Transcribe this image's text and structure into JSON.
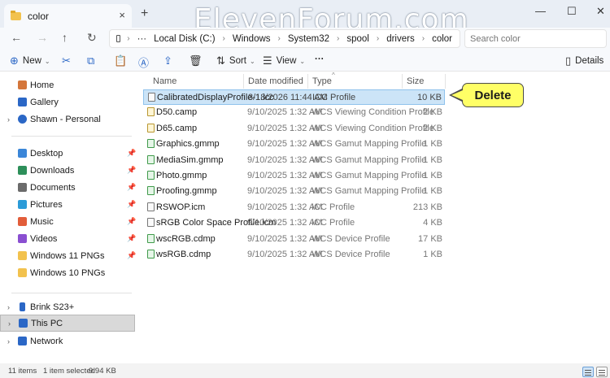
{
  "window": {
    "tab_title": "color",
    "tab_close": "×",
    "new_tab": "+",
    "watermark": "ElevenForum.com",
    "minimize": "—",
    "maximize": "☐",
    "close": "✕"
  },
  "address": {
    "back": "←",
    "forward": "→",
    "up": "↑",
    "refresh": "↻",
    "more": "···",
    "breadcrumbs": [
      "Local Disk (C:)",
      "Windows",
      "System32",
      "spool",
      "drivers",
      "color"
    ],
    "separator": "›",
    "search_placeholder": "Search color"
  },
  "toolbar": {
    "new_label": "New",
    "sort_label": "Sort",
    "view_label": "View",
    "more_label": "···",
    "details_label": "Details"
  },
  "nav": {
    "items": [
      {
        "label": "Home",
        "icon": "home-icon",
        "color": "#d4763b"
      },
      {
        "label": "Gallery",
        "icon": "gallery-icon",
        "color": "#2b67c6"
      },
      {
        "label": "Shawn - Personal",
        "icon": "cloud-icon",
        "color": "#2b67c6"
      }
    ],
    "quick": [
      {
        "label": "Desktop",
        "icon": "desktop-icon",
        "color": "#3b86d8"
      },
      {
        "label": "Downloads",
        "icon": "download-icon",
        "color": "#2d8f5a"
      },
      {
        "label": "Documents",
        "icon": "document-icon",
        "color": "#6b6b6b"
      },
      {
        "label": "Pictures",
        "icon": "pictures-icon",
        "color": "#2b9bd8"
      },
      {
        "label": "Music",
        "icon": "music-icon",
        "color": "#e25d3a"
      },
      {
        "label": "Videos",
        "icon": "video-icon",
        "color": "#8a4fd1"
      },
      {
        "label": "Windows 11 PNGs",
        "icon": "folder-icon",
        "color": "#f2c24e"
      },
      {
        "label": "Windows 10 PNGs",
        "icon": "folder-icon",
        "color": "#f2c24e"
      }
    ],
    "devices": [
      {
        "label": "Brink S23+",
        "icon": "phone-icon",
        "color": "#2b67c6"
      },
      {
        "label": "This PC",
        "icon": "pc-icon",
        "color": "#2b67c6"
      },
      {
        "label": "Network",
        "icon": "network-icon",
        "color": "#2b67c6"
      }
    ],
    "pin_glyph": "📌"
  },
  "columns": {
    "name": "Name",
    "date": "Date modified",
    "type": "Type",
    "size": "Size"
  },
  "files": [
    {
      "name": "CalibratedDisplayProfile-1.icc",
      "date": "3/18/2026 11:44 AM",
      "type": "ICC Profile",
      "size": "10 KB",
      "kind": "icc"
    },
    {
      "name": "D50.camp",
      "date": "9/10/2025 1:32 AM",
      "type": "WCS Viewing Condition Profile",
      "size": "2 KB",
      "kind": "camp"
    },
    {
      "name": "D65.camp",
      "date": "9/10/2025 1:32 AM",
      "type": "WCS Viewing Condition Profile",
      "size": "2 KB",
      "kind": "camp"
    },
    {
      "name": "Graphics.gmmp",
      "date": "9/10/2025 1:32 AM",
      "type": "WCS Gamut Mapping Profile",
      "size": "1 KB",
      "kind": "gmmp"
    },
    {
      "name": "MediaSim.gmmp",
      "date": "9/10/2025 1:32 AM",
      "type": "WCS Gamut Mapping Profile",
      "size": "1 KB",
      "kind": "gmmp"
    },
    {
      "name": "Photo.gmmp",
      "date": "9/10/2025 1:32 AM",
      "type": "WCS Gamut Mapping Profile",
      "size": "1 KB",
      "kind": "gmmp"
    },
    {
      "name": "Proofing.gmmp",
      "date": "9/10/2025 1:32 AM",
      "type": "WCS Gamut Mapping Profile",
      "size": "1 KB",
      "kind": "gmmp"
    },
    {
      "name": "RSWOP.icm",
      "date": "9/10/2025 1:32 AM",
      "type": "ICC Profile",
      "size": "213 KB",
      "kind": "icc"
    },
    {
      "name": "sRGB Color Space Profile.icm",
      "date": "9/10/2025 1:32 AM",
      "type": "ICC Profile",
      "size": "4 KB",
      "kind": "icc"
    },
    {
      "name": "wscRGB.cdmp",
      "date": "9/10/2025 1:32 AM",
      "type": "WCS Device Profile",
      "size": "17 KB",
      "kind": "cdmp"
    },
    {
      "name": "wsRGB.cdmp",
      "date": "9/10/2025 1:32 AM",
      "type": "WCS Device Profile",
      "size": "1 KB",
      "kind": "cdmp"
    }
  ],
  "callout": {
    "label": "Delete"
  },
  "status": {
    "items": "11 items",
    "selected": "1 item selected",
    "size": "9.94 KB"
  }
}
